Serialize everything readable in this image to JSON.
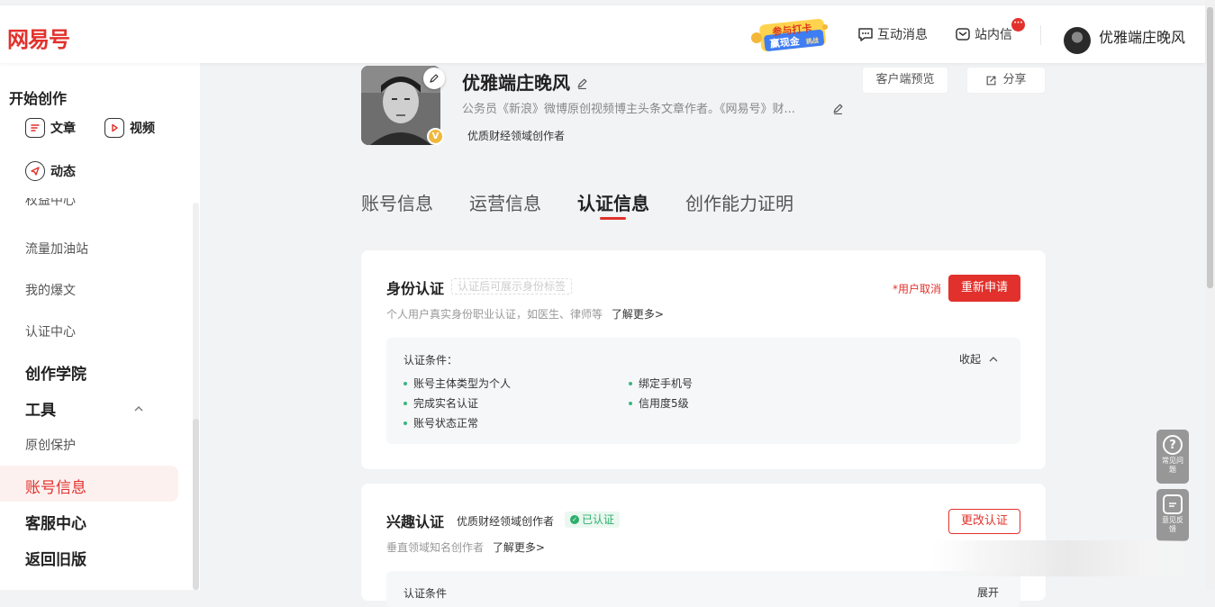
{
  "header": {
    "logo": "网易号",
    "promo_line1": "参与打卡",
    "promo_line2": "赢现金",
    "promo_tag": "挑战",
    "nav_messages": "互动消息",
    "nav_inbox": "站内信",
    "inbox_badge": "···",
    "username": "优雅端庄晚风"
  },
  "sidebar": {
    "section_create": "开始创作",
    "btn_article": "文章",
    "btn_video": "视频",
    "btn_dynamic": "动态",
    "items": [
      {
        "label": "权益中心"
      },
      {
        "label": "流量加油站"
      },
      {
        "label": "我的爆文"
      },
      {
        "label": "认证中心"
      }
    ],
    "academy": "创作学院",
    "tools": "工具",
    "original_protect": "原创保护",
    "account_info": "账号信息",
    "service_center": "客服中心",
    "back_old": "返回旧版"
  },
  "profile": {
    "name": "优雅端庄晚风",
    "bio": "公务员《新浪》微博原创视频博主头条文章作者。《网易号》财...",
    "tag": "优质财经领域创作者",
    "v_badge": "V",
    "preview_button": "客户端预览",
    "share_button": "分享"
  },
  "tabs": [
    {
      "label": "账号信息"
    },
    {
      "label": "运营信息"
    },
    {
      "label": "认证信息"
    },
    {
      "label": "创作能力证明"
    }
  ],
  "identity": {
    "title": "身份认证",
    "hint": "认证后可展示身份标签",
    "desc": "个人用户真实身份职业认证，如医生、律师等",
    "more": "了解更多>",
    "status": "*用户取消",
    "reapply": "重新申请",
    "cond_label": "认证条件：",
    "collapse": "收起",
    "conditions_left": [
      "账号主体类型为个人",
      "完成实名认证",
      "账号状态正常"
    ],
    "conditions_right": [
      "绑定手机号",
      "信用度5级"
    ]
  },
  "interest": {
    "title": "兴趣认证",
    "tag": "优质财经领域创作者",
    "verified": "已认证",
    "desc": "垂直领域知名创作者",
    "more": "了解更多>",
    "change": "更改认证",
    "cond_label": "认证条件",
    "expand": "展开"
  },
  "floating": {
    "faq": "常见问题",
    "feedback": "意见反馈"
  },
  "colors": {
    "brand": "#e2312c",
    "verified": "#2eae6c"
  }
}
